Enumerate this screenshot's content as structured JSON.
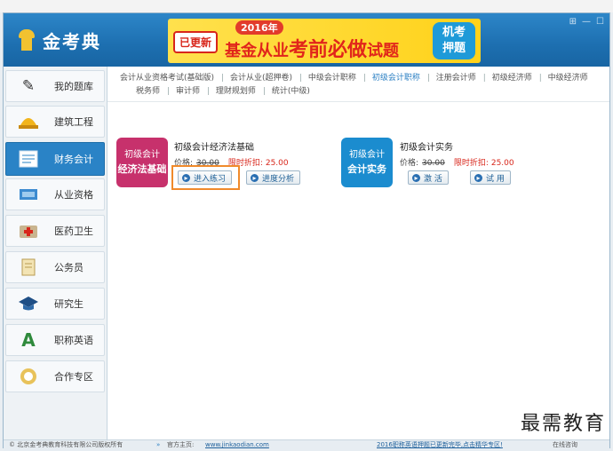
{
  "app": {
    "logo_text": "金考典",
    "window_controls": [
      "⊞",
      "—",
      "☐"
    ]
  },
  "banner": {
    "updated": "已更新",
    "year": "2016年",
    "headline_a": "基金从业",
    "headline_b": "考前必做",
    "headline_c": "试题",
    "tag_line1": "机考",
    "tag_line2": "押题"
  },
  "sidebar": {
    "items": [
      {
        "label": "我的题库",
        "icon": "pen-icon"
      },
      {
        "label": "建筑工程",
        "icon": "hardhat-icon"
      },
      {
        "label": "财务会计",
        "icon": "ledger-icon",
        "active": true
      },
      {
        "label": "从业资格",
        "icon": "certificate-icon"
      },
      {
        "label": "医药卫生",
        "icon": "medical-icon"
      },
      {
        "label": "公务员",
        "icon": "document-icon"
      },
      {
        "label": "研究生",
        "icon": "graduation-cap-icon"
      },
      {
        "label": "职称英语",
        "icon": "letter-a-icon"
      },
      {
        "label": "合作专区",
        "icon": "handshake-icon"
      }
    ]
  },
  "categories": {
    "row1": [
      "会计从业资格考试(基础版)",
      "会计从业(超押卷)",
      "中级会计职称",
      "初级会计职称",
      "注册会计师",
      "初级经济师",
      "中级经济师"
    ],
    "row2": [
      "税务师",
      "审计师",
      "理财规划师",
      "统计(中级)"
    ],
    "active": "初级会计职称"
  },
  "products": [
    {
      "thumb_line1": "初级会计",
      "thumb_line2": "经济法基础",
      "thumb_color": "#c7316c",
      "title": "初级会计经济法基础",
      "price_label": "价格:",
      "price_old": "30.00",
      "discount_label": "限时折扣:",
      "discount_price": "25.00",
      "btn1": "进入练习",
      "btn2": "进度分析"
    },
    {
      "thumb_line1": "初级会计",
      "thumb_line2": "会计实务",
      "thumb_color": "#1b8ccf",
      "title": "初级会计实务",
      "price_label": "价格:",
      "price_old": "30.00",
      "discount_label": "限时折扣:",
      "discount_price": "25.00",
      "btn1": "激 活",
      "btn2": "试 用"
    }
  ],
  "footer": {
    "copyright": "© 北京金考典教育科技有限公司版权所有",
    "home_label": "官方主页:",
    "home_url": "www.jinkaodian.com",
    "promo_link": "2016职称英语押题已更新完毕,点击精华专区!",
    "online": "在线咨询"
  },
  "watermark": "最需教育"
}
